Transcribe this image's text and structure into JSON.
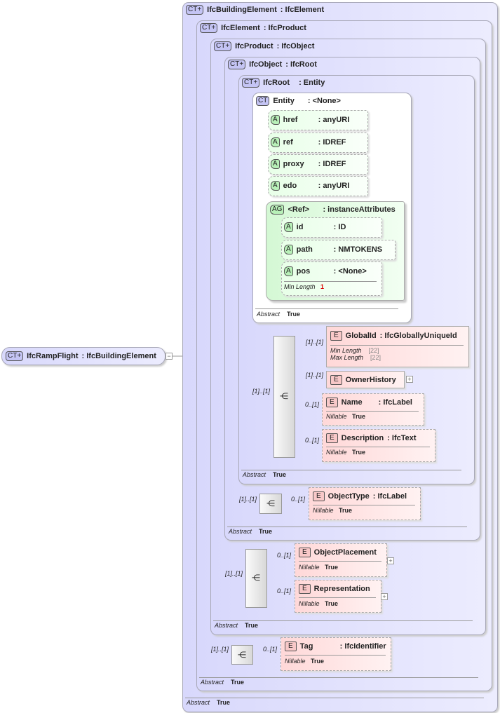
{
  "root": {
    "badge": "CT+",
    "name": "IfcRampFlight",
    "type": ": IfcBuildingElement",
    "collapse": "−"
  },
  "types": [
    {
      "badge": "CT+",
      "name": "IfcBuildingElement",
      "type": ": IfcElement",
      "abstract_label": "Abstract",
      "abstract_value": "True"
    },
    {
      "badge": "CT+",
      "name": "IfcElement",
      "type": ": IfcProduct",
      "abstract_label": "Abstract",
      "abstract_value": "True"
    },
    {
      "badge": "CT+",
      "name": "IfcProduct",
      "type": ": IfcObject",
      "abstract_label": "Abstract",
      "abstract_value": "True"
    },
    {
      "badge": "CT+",
      "name": "IfcObject",
      "type": ": IfcRoot",
      "abstract_label": "Abstract",
      "abstract_value": "True"
    },
    {
      "badge": "CT+",
      "name": "IfcRoot",
      "type": ": Entity",
      "abstract_label": "Abstract",
      "abstract_value": "True"
    },
    {
      "badge": "CT",
      "name": "Entity",
      "type": ": <None>",
      "abstract_label": "Abstract",
      "abstract_value": "True"
    }
  ],
  "attributes": [
    {
      "badge": "A",
      "name": "href",
      "type": ": anyURI"
    },
    {
      "badge": "A",
      "name": "ref",
      "type": ": IDREF"
    },
    {
      "badge": "A",
      "name": "proxy",
      "type": ": IDREF"
    },
    {
      "badge": "A",
      "name": "edo",
      "type": ": anyURI"
    }
  ],
  "attribute_group": {
    "badge": "AG",
    "name": "<Ref>",
    "type": ": instanceAttributes",
    "attributes": [
      {
        "badge": "A",
        "name": "id",
        "type": ": ID"
      },
      {
        "badge": "A",
        "name": "path",
        "type": ": NMTOKENS"
      },
      {
        "badge": "A",
        "name": "pos",
        "type": ": <None>",
        "facet_label": "Min Length",
        "facet_value": "1"
      }
    ]
  },
  "elements": {
    "globalid": {
      "badge": "E",
      "name": "GlobalId",
      "type": ": IfcGloballyUniqueId",
      "card": "[1]..[1]",
      "facets": [
        {
          "label": "Min Length",
          "value": "[22]"
        },
        {
          "label": "Max Length",
          "value": "[22]"
        }
      ]
    },
    "ownerhistory": {
      "badge": "E",
      "name": "OwnerHistory",
      "card": "[1]..[1]",
      "expand": "+"
    },
    "name": {
      "badge": "E",
      "name": "Name",
      "type": ": IfcLabel",
      "card": "0..[1]",
      "nillable_label": "Nillable",
      "nillable_value": "True"
    },
    "description": {
      "badge": "E",
      "name": "Description",
      "type": ": IfcText",
      "card": "0..[1]",
      "nillable_label": "Nillable",
      "nillable_value": "True"
    },
    "objecttype": {
      "badge": "E",
      "name": "ObjectType",
      "type": ": IfcLabel",
      "card": "0..[1]",
      "nillable_label": "Nillable",
      "nillable_value": "True"
    },
    "objectplacement": {
      "badge": "E",
      "name": "ObjectPlacement",
      "card": "0..[1]",
      "nillable_label": "Nillable",
      "nillable_value": "True",
      "expand": "+"
    },
    "representation": {
      "badge": "E",
      "name": "Representation",
      "card": "0..[1]",
      "nillable_label": "Nillable",
      "nillable_value": "True",
      "expand": "+"
    },
    "tag": {
      "badge": "E",
      "name": "Tag",
      "type": ": IfcIdentifier",
      "card": "0..[1]",
      "nillable_label": "Nillable",
      "nillable_value": "True"
    }
  },
  "sequences": {
    "root": "[1]..[1]",
    "object": "[1]..[1]",
    "product": "[1]..[1]",
    "element": "[1]..[1]"
  },
  "colors": {
    "complex_type": "#dcdcfc",
    "attribute": "#e0ffe0",
    "element": "#ffdcdc"
  }
}
